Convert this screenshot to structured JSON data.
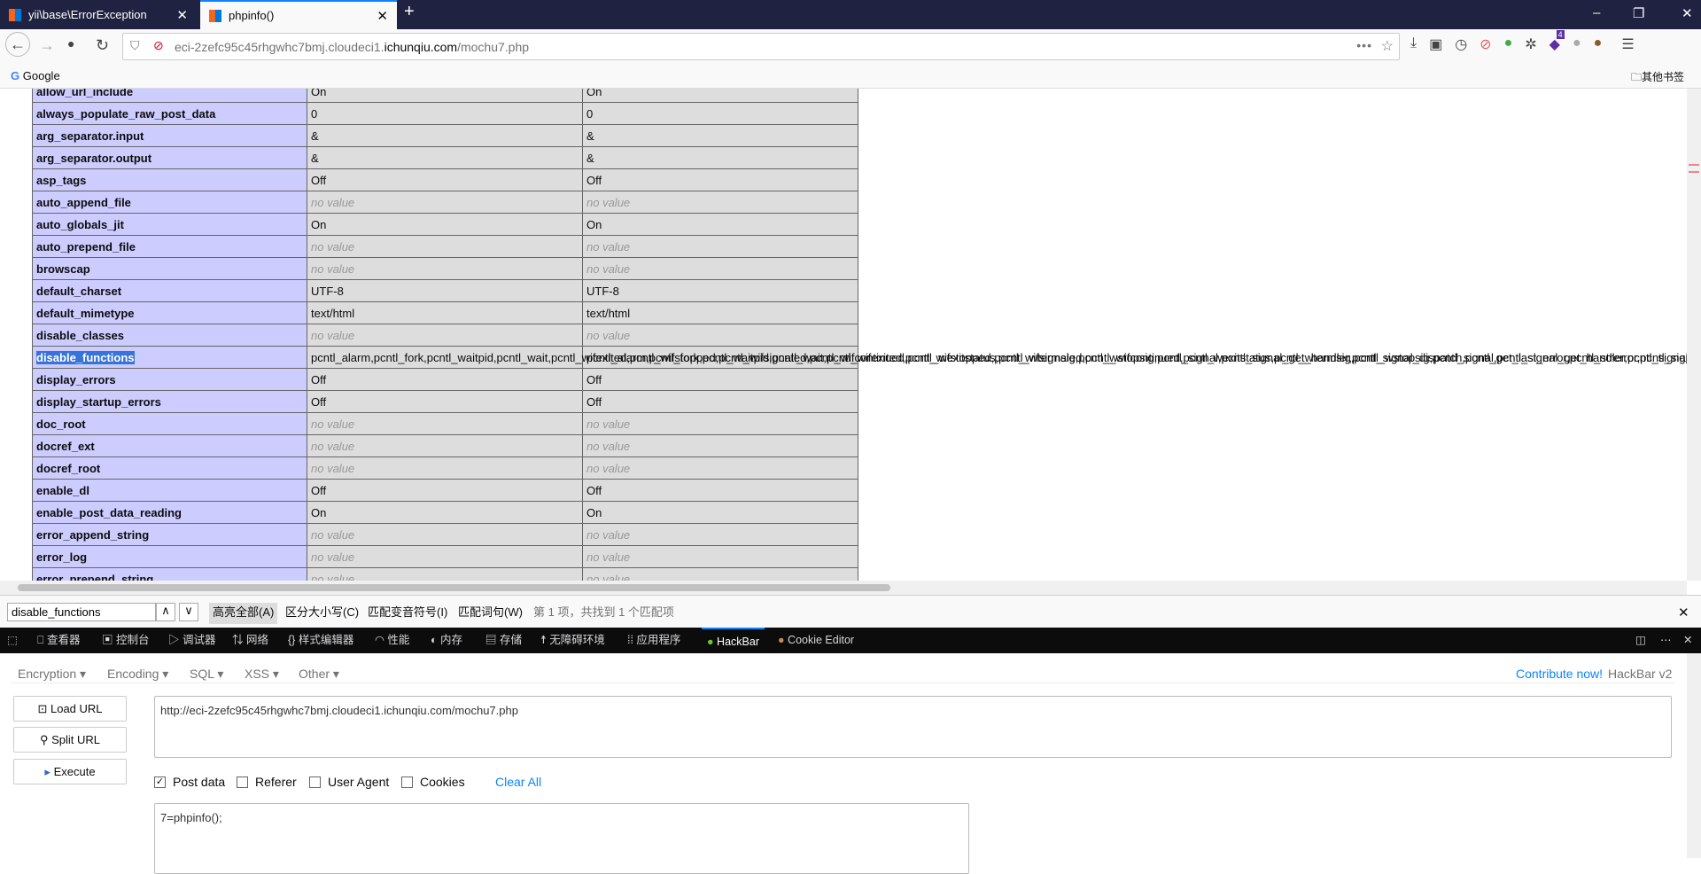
{
  "tabs": [
    {
      "title": "yii\\base\\ErrorException",
      "active": false
    },
    {
      "title": "phpinfo()",
      "active": true
    }
  ],
  "url": {
    "prefix": "eci-2zefc95c45rhgwhc7bmj.cloudeci1.",
    "domain": "ichunqiu.com",
    "path": "/mochu7.php"
  },
  "bookmarks": {
    "google": "Google",
    "other": "其他书签"
  },
  "extension_badge": "4",
  "table_rows": [
    [
      "allow_url_include",
      "On",
      "On"
    ],
    [
      "always_populate_raw_post_data",
      "0",
      "0"
    ],
    [
      "arg_separator.input",
      "&",
      "&"
    ],
    [
      "arg_separator.output",
      "&",
      "&"
    ],
    [
      "asp_tags",
      "Off",
      "Off"
    ],
    [
      "auto_append_file",
      "no value",
      "no value"
    ],
    [
      "auto_globals_jit",
      "On",
      "On"
    ],
    [
      "auto_prepend_file",
      "no value",
      "no value"
    ],
    [
      "browscap",
      "no value",
      "no value"
    ],
    [
      "default_charset",
      "UTF-8",
      "UTF-8"
    ],
    [
      "default_mimetype",
      "text/html",
      "text/html"
    ],
    [
      "disable_classes",
      "no value",
      "no value"
    ],
    [
      "disable_functions",
      "pcntl_alarm,pcntl_fork,pcntl_waitpid,pcntl_wait,pcntl_wifexited,pcntl_wifstopped,pcntl_wifsignaled,pcntl_wifcontinued,pcntl_wexitstatus,pcntl_wtermsig,pcntl_wstopsig,pcntl_signal,pcntl_signal_get_handler,pcntl_signal_dispatch,pcntl_get_last_error,pcntl_strerror,pcntl_sigprocmask,pcntl_sigwaitinfo,pcntl_sigtimedwait,pcntl_exec,pcntl_getpriority,pcntl_setpriority,pcntl_async_signals",
      "pcntl_alarm,pcntl_fork,pcntl_waitpid,pcntl_wait,pcntl_wifexited,pcntl_wifstopped,pcntl_wifsignaled,pcntl_wifcontinued,pcntl_wexitstatus,pcntl_wtermsig,pcntl_wstopsig,pcntl_signal,pcntl_signal_get_handler,pcntl_signal_dispatch,pcntl_get_last_error,pcntl_strerror,pcntl_sigprocmask,pcntl_sigwaitinfo,pcntl_sigtimedwait,pcntl_exec,pcntl_getpriority,pcntl_setpriority,pcntl_async_signals"
    ],
    [
      "display_errors",
      "Off",
      "Off"
    ],
    [
      "display_startup_errors",
      "Off",
      "Off"
    ],
    [
      "doc_root",
      "no value",
      "no value"
    ],
    [
      "docref_ext",
      "no value",
      "no value"
    ],
    [
      "docref_root",
      "no value",
      "no value"
    ],
    [
      "enable_dl",
      "Off",
      "Off"
    ],
    [
      "enable_post_data_reading",
      "On",
      "On"
    ],
    [
      "error_append_string",
      "no value",
      "no value"
    ],
    [
      "error_log",
      "no value",
      "no value"
    ],
    [
      "error_prepend_string",
      "no value",
      "no value"
    ]
  ],
  "highlighted_row": "disable_functions",
  "findbar": {
    "query": "disable_functions",
    "highlight_all": "高亮全部(A)",
    "match_case": "区分大小写(C)",
    "match_diacritics": "匹配变音符号(I)",
    "whole_words": "匹配词句(W)",
    "status": "第 1 项，共找到 1 个匹配项"
  },
  "devtools": {
    "tabs": [
      "查看器",
      "控制台",
      "调试器",
      "网络",
      "样式编辑器",
      "性能",
      "内存",
      "存储",
      "无障碍环境",
      "应用程序",
      "HackBar",
      "Cookie Editor"
    ],
    "active": "HackBar"
  },
  "hackbar": {
    "menus": [
      "Encryption",
      "Encoding",
      "SQL",
      "XSS",
      "Other"
    ],
    "contribute": "Contribute now!",
    "version": "HackBar v2",
    "buttons": {
      "load": "Load URL",
      "split": "Split URL",
      "execute": "Execute"
    },
    "url_value": "http://eci-2zefc95c45rhgwhc7bmj.cloudeci1.ichunqiu.com/mochu7.php",
    "options": [
      {
        "label": "Post data",
        "checked": true
      },
      {
        "label": "Referer",
        "checked": false
      },
      {
        "label": "User Agent",
        "checked": false
      },
      {
        "label": "Cookies",
        "checked": false
      }
    ],
    "clear_all": "Clear All",
    "post_value": "7=phpinfo();"
  }
}
